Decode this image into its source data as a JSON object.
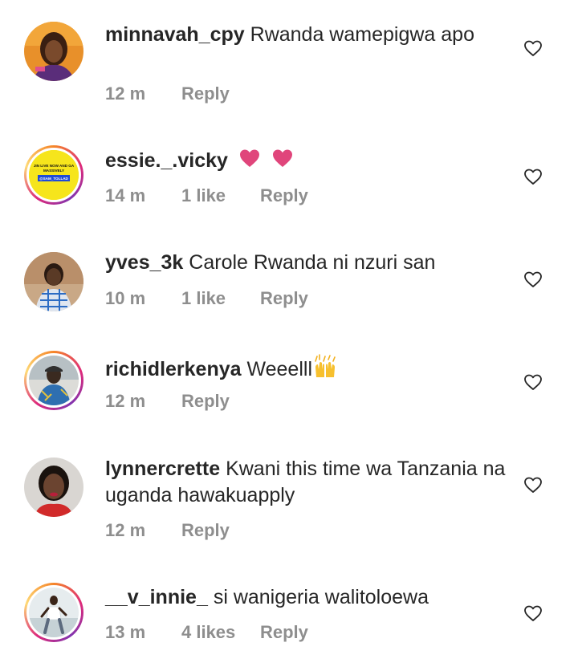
{
  "colors": {
    "text": "#262626",
    "meta": "#8e8e8e",
    "heart_emoji": "#e0457b"
  },
  "comments": [
    {
      "username": "minnavah_cpy",
      "text": "Rwanda wamepigwa apo",
      "time": "12 m",
      "likes": "",
      "reply": "Reply",
      "avatar_icon": "profile-photo-woman"
    },
    {
      "username": "essie._.vicky",
      "text": "",
      "emoji": "heart-emoji-x2",
      "time": "14 m",
      "likes": "1 like",
      "reply": "Reply",
      "avatar_lines": [
        "JIN LIVE NOW AND GA",
        "MASSIVELY",
        "@SAM_TOLLAD"
      ]
    },
    {
      "username": "yves_3k",
      "text": "Carole Rwanda ni nzuri san",
      "time": "10 m",
      "likes": "1 like",
      "reply": "Reply",
      "avatar_icon": "profile-photo-man"
    },
    {
      "username": "richidlerkenya",
      "text": "Weeelll",
      "emoji": "raising-hands-emoji",
      "time": "12 m",
      "likes": "",
      "reply": "Reply",
      "avatar_icon": "profile-photo-man-cap"
    },
    {
      "username": "lynnercrette",
      "text": "Kwani this time wa Tanzania na uganda hawakuapply",
      "time": "12 m",
      "likes": "",
      "reply": "Reply",
      "avatar_icon": "profile-photo-woman"
    },
    {
      "username": "__v_innie_",
      "text": "si wanigeria walitoloewa",
      "time": "13 m",
      "likes": "4 likes",
      "reply": "Reply",
      "avatar_icon": "profile-photo-person-standing"
    }
  ]
}
